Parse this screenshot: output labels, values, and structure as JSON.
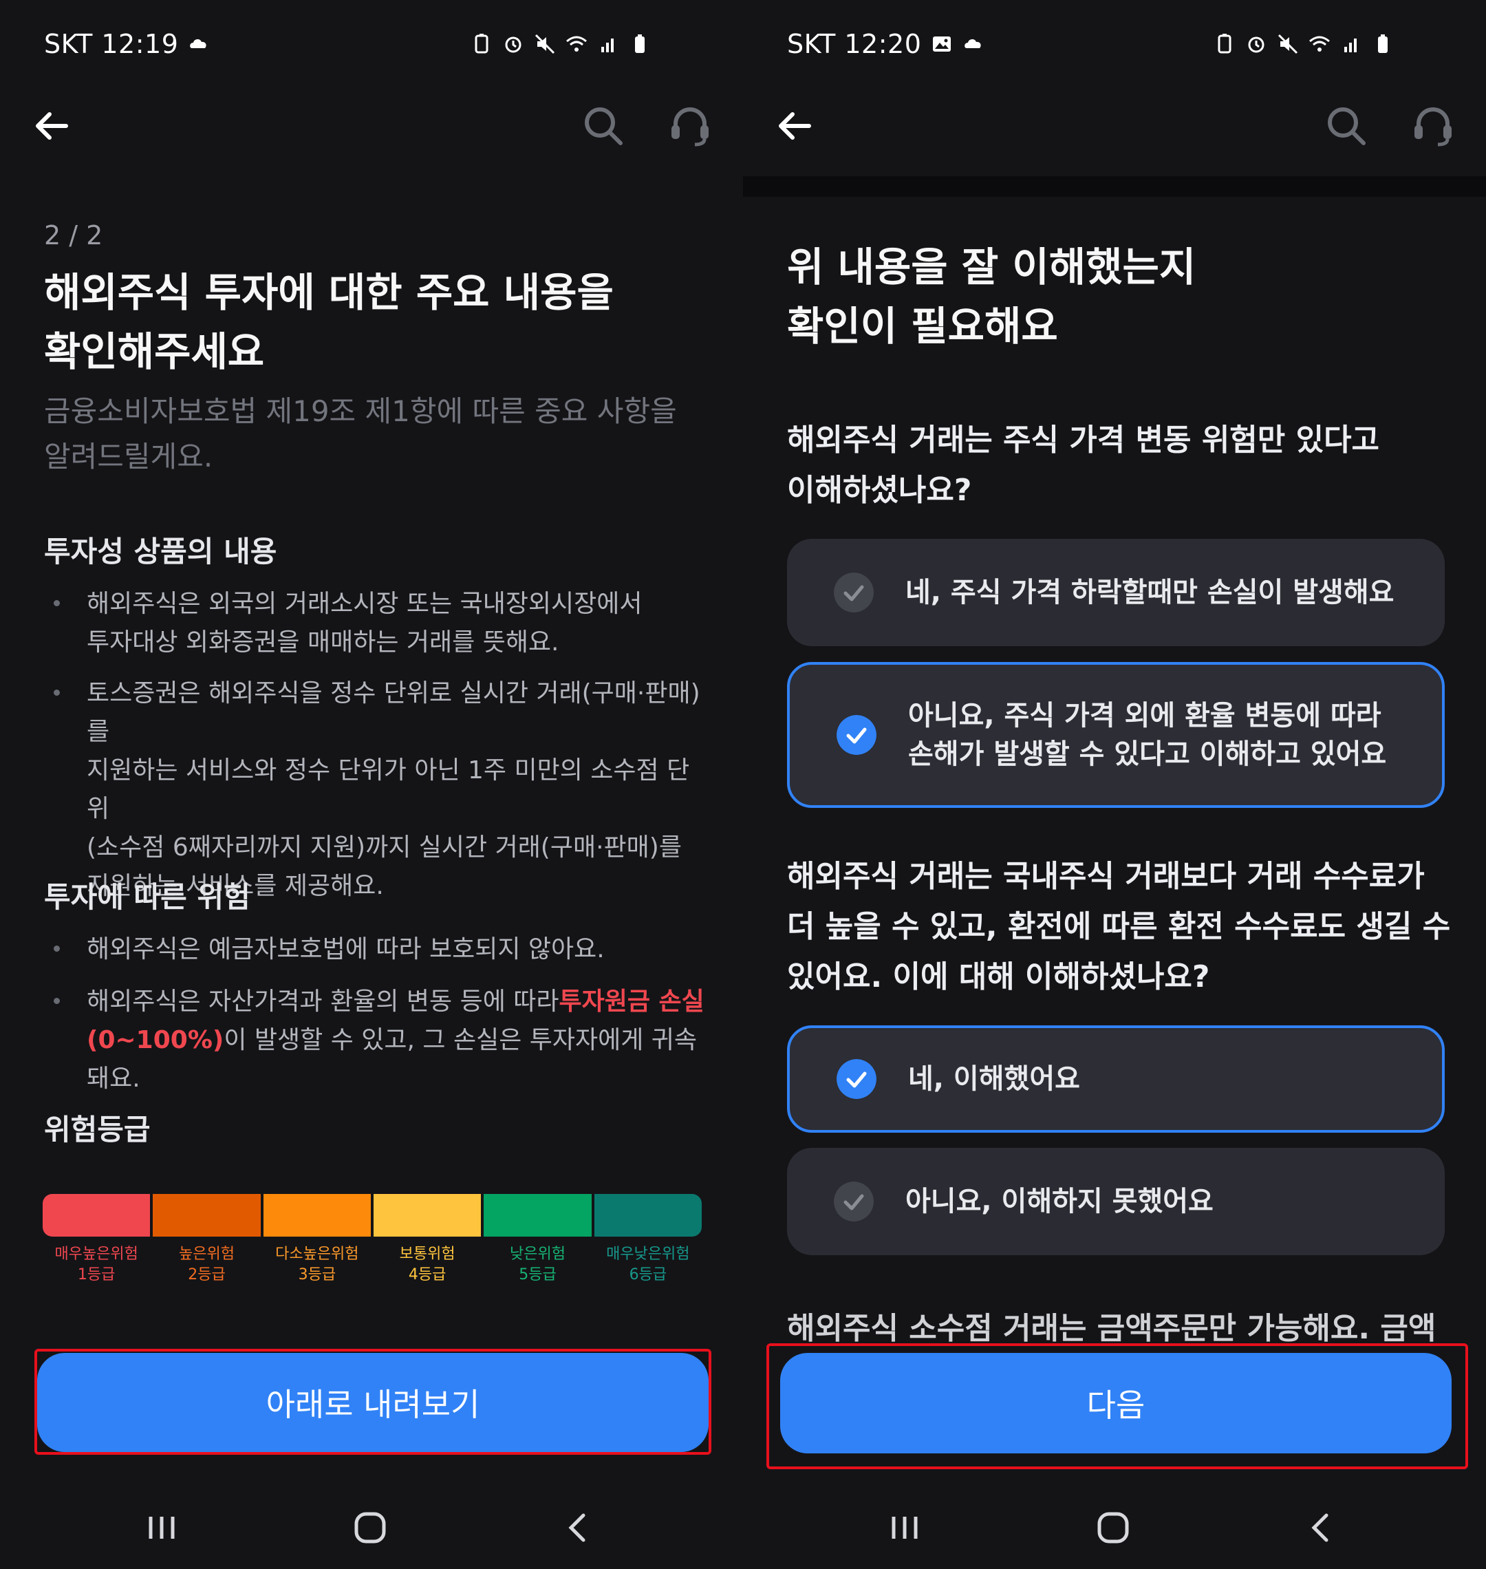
{
  "left": {
    "status": {
      "carrier_time": "SKT 12:19"
    },
    "page_index": "2 / 2",
    "title_line1": "해외주식 투자에 대한 주요 내용을",
    "title_line2": "확인해주세요",
    "subtitle_line1": "금융소비자보호법 제19조 제1항에 따른 중요 사항을",
    "subtitle_line2": "알려드릴게요.",
    "section1": {
      "heading": "투자성 상품의 내용",
      "bullets": [
        {
          "lines": [
            "해외주식은 외국의 거래소시장 또는 국내장외시장에서",
            "투자대상 외화증권을 매매하는 거래를 뜻해요."
          ]
        },
        {
          "lines": [
            "토스증권은 해외주식을 정수 단위로 실시간 거래(구매·판매)를",
            "지원하는 서비스와 정수 단위가 아닌 1주 미만의 소수점 단위",
            "(소수점 6째자리까지 지원)까지 실시간 거래(구매·판매)를",
            "지원하는 서비스를 제공해요."
          ]
        }
      ]
    },
    "section2": {
      "heading": "투자에 따른 위험",
      "bullet1": "해외주식은 예금자보호법에 따라 보호되지 않아요.",
      "bullet2_pre": "해외주식은 자산가격과 환율의 변동 등에 따라",
      "bullet2_red1": "투자원금 손실",
      "bullet2_red2": "(0~100%)",
      "bullet2_post": "이 발생할 수 있고, 그 손실은 투자자에게 귀속돼요."
    },
    "risk": {
      "heading": "위험등급",
      "grades": [
        {
          "name": "매우높은위험",
          "grade": "1등급",
          "color": "#f0474f",
          "text_color": "#f0474f"
        },
        {
          "name": "높은위험",
          "grade": "2등급",
          "color": "#e25a00",
          "text_color": "#f26d20"
        },
        {
          "name": "다소높은위험",
          "grade": "3등급",
          "color": "#fd8a0a",
          "text_color": "#fd9a2a"
        },
        {
          "name": "보통위험",
          "grade": "4등급",
          "color": "#ffc43d",
          "text_color": "#ffc43d"
        },
        {
          "name": "낮은위험",
          "grade": "5등급",
          "color": "#04a463",
          "text_color": "#16b373"
        },
        {
          "name": "매우낮은위험",
          "grade": "6등급",
          "color": "#0a7a6f",
          "text_color": "#16998c"
        }
      ]
    },
    "button": "아래로 내려보기"
  },
  "right": {
    "status": {
      "carrier_time": "SKT 12:20"
    },
    "title_line1": "위 내용을 잘 이해했는지",
    "title_line2": "확인이 필요해요",
    "q1_line1": "해외주식 거래는 주식 가격 변동 위험만 있다고",
    "q1_line2": "이해하셨나요?",
    "q1_options": [
      {
        "lines": [
          "네, 주식 가격 하락할때만 손실이 발생해요"
        ],
        "selected": false
      },
      {
        "lines": [
          "아니요, 주식 가격 외에 환율 변동에 따라",
          "손해가 발생할 수 있다고 이해하고 있어요"
        ],
        "selected": true
      }
    ],
    "q2_line1": "해외주식 거래는 국내주식 거래보다 거래 수수료가",
    "q2_line2": "더 높을 수 있고, 환전에 따른 환전 수수료도 생길 수",
    "q2_line3": "있어요. 이에 대해 이해하셨나요?",
    "q2_options": [
      {
        "lines": [
          "네, 이해했어요"
        ],
        "selected": true
      },
      {
        "lines": [
          "아니요, 이해하지 못했어요"
        ],
        "selected": false
      }
    ],
    "q3_partial": "해외주식 소수점 거래는 금액주문만 가능해요. 금액",
    "button": "다음"
  },
  "colors": {
    "accent": "#3182f6",
    "highlight_outline": "#e8101c",
    "background": "#141417"
  }
}
